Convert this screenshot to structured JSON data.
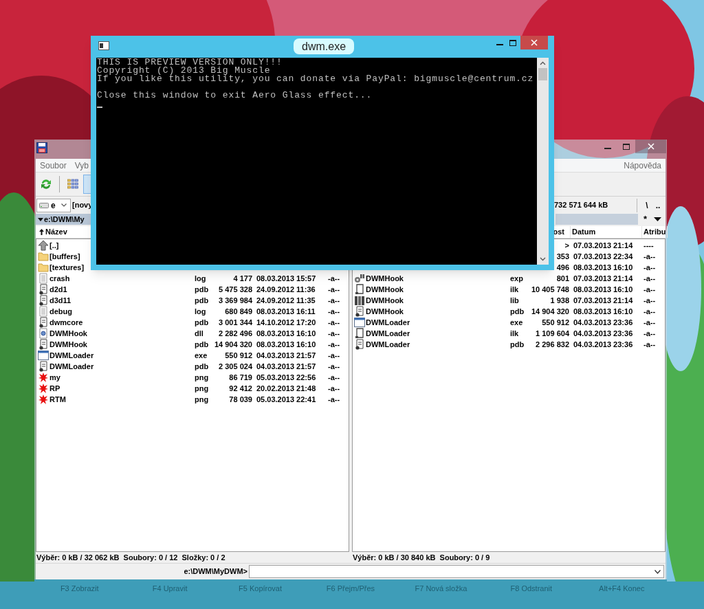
{
  "console": {
    "title": "dwm.exe",
    "paragraphs": [
      [
        "THIS IS PREVIEW VERSION ONLY!!!",
        "Copyright (C) 2013 Big Muscle",
        "If you like this utility, you can donate via PayPal: bigmuscle@centrum.cz"
      ],
      [
        "Close this window to exit Aero Glass effect..."
      ]
    ]
  },
  "file_manager": {
    "menu_left": [
      "Soubor",
      "Vyb"
    ],
    "menu_right": [
      "Nápověda"
    ],
    "left_panel": {
      "drive": "e",
      "drive_label": "[novy",
      "path": "e:\\DWM\\My",
      "sort_ascending": true,
      "columns": {
        "name": "Název"
      },
      "rows": [
        {
          "kind": "up",
          "name": "[..]"
        },
        {
          "kind": "folder",
          "name": "[buffers]"
        },
        {
          "kind": "folder",
          "name": "[textures]"
        },
        {
          "kind": "text",
          "name": "crash",
          "ext": "log",
          "size": "4 177",
          "date": "08.03.2013 15:57",
          "attr": "-a--"
        },
        {
          "kind": "pdb",
          "name": "d2d1",
          "ext": "pdb",
          "size": "5 475 328",
          "date": "24.09.2012 11:36",
          "attr": "-a--"
        },
        {
          "kind": "pdb",
          "name": "d3d11",
          "ext": "pdb",
          "size": "3 369 984",
          "date": "24.09.2012 11:35",
          "attr": "-a--"
        },
        {
          "kind": "text",
          "name": "debug",
          "ext": "log",
          "size": "680 849",
          "date": "08.03.2013 16:11",
          "attr": "-a--"
        },
        {
          "kind": "pdb",
          "name": "dwmcore",
          "ext": "pdb",
          "size": "3 001 344",
          "date": "14.10.2012 17:20",
          "attr": "-a--"
        },
        {
          "kind": "dll",
          "name": "DWMHook",
          "ext": "dll",
          "size": "2 282 496",
          "date": "08.03.2013 16:10",
          "attr": "-a--"
        },
        {
          "kind": "pdb",
          "name": "DWMHook",
          "ext": "pdb",
          "size": "14 904 320",
          "date": "08.03.2013 16:10",
          "attr": "-a--"
        },
        {
          "kind": "exe",
          "name": "DWMLoader",
          "ext": "exe",
          "size": "550 912",
          "date": "04.03.2013 21:57",
          "attr": "-a--"
        },
        {
          "kind": "pdb",
          "name": "DWMLoader",
          "ext": "pdb",
          "size": "2 305 024",
          "date": "04.03.2013 21:57",
          "attr": "-a--"
        },
        {
          "kind": "png",
          "name": "my",
          "ext": "png",
          "size": "86 719",
          "date": "05.03.2013 22:56",
          "attr": "-a--"
        },
        {
          "kind": "png",
          "name": "RP",
          "ext": "png",
          "size": "92 412",
          "date": "20.02.2013 21:48",
          "attr": "-a--"
        },
        {
          "kind": "png",
          "name": "RTM",
          "ext": "png",
          "size": "78 039",
          "date": "05.03.2013 22:41",
          "attr": "-a--"
        }
      ],
      "status": "Výběr: 0 kB / 32 062 kB  Soubory: 0 / 12  Složky: 0 / 2"
    },
    "right_panel": {
      "free_space": "732 571 644 kB",
      "root_button": "\\",
      "parent_button": "..",
      "filter": "*",
      "columns": {
        "size": "ost",
        "date": "Datum",
        "attr": "Atribu"
      },
      "rows": [
        {
          "size": ">",
          "date": "07.03.2013 21:14",
          "attr": "----"
        },
        {
          "size": "353",
          "date": "07.03.2013 22:34",
          "attr": "-a--"
        },
        {
          "size": "496",
          "date": "08.03.2013 16:10",
          "attr": "-a--"
        },
        {
          "kind": "exp",
          "name": "DWMHook",
          "ext": "exp",
          "size": "801",
          "date": "07.03.2013 21:14",
          "attr": "-a--"
        },
        {
          "kind": "ilk",
          "name": "DWMHook",
          "ext": "ilk",
          "size": "10 405 748",
          "date": "08.03.2013 16:10",
          "attr": "-a--"
        },
        {
          "kind": "lib",
          "name": "DWMHook",
          "ext": "lib",
          "size": "1 938",
          "date": "07.03.2013 21:14",
          "attr": "-a--"
        },
        {
          "kind": "pdb",
          "name": "DWMHook",
          "ext": "pdb",
          "size": "14 904 320",
          "date": "08.03.2013 16:10",
          "attr": "-a--"
        },
        {
          "kind": "exe",
          "name": "DWMLoader",
          "ext": "exe",
          "size": "550 912",
          "date": "04.03.2013 23:36",
          "attr": "-a--"
        },
        {
          "kind": "ilk",
          "name": "DWMLoader",
          "ext": "ilk",
          "size": "1 109 604",
          "date": "04.03.2013 23:36",
          "attr": "-a--"
        },
        {
          "kind": "pdb",
          "name": "DWMLoader",
          "ext": "pdb",
          "size": "2 296 832",
          "date": "04.03.2013 23:36",
          "attr": "-a--"
        }
      ],
      "status": "Výběr: 0 kB / 30 840 kB  Soubory: 0 / 9"
    },
    "command_prompt": "e:\\DWM\\MyDWM>",
    "function_keys": [
      "F3 Zobrazit",
      "F4 Upravit",
      "F5 Kopírovat",
      "F6 Přejm/Přes",
      "F7 Nová složka",
      "F8 Odstranit",
      "Alt+F4 Konec"
    ]
  }
}
